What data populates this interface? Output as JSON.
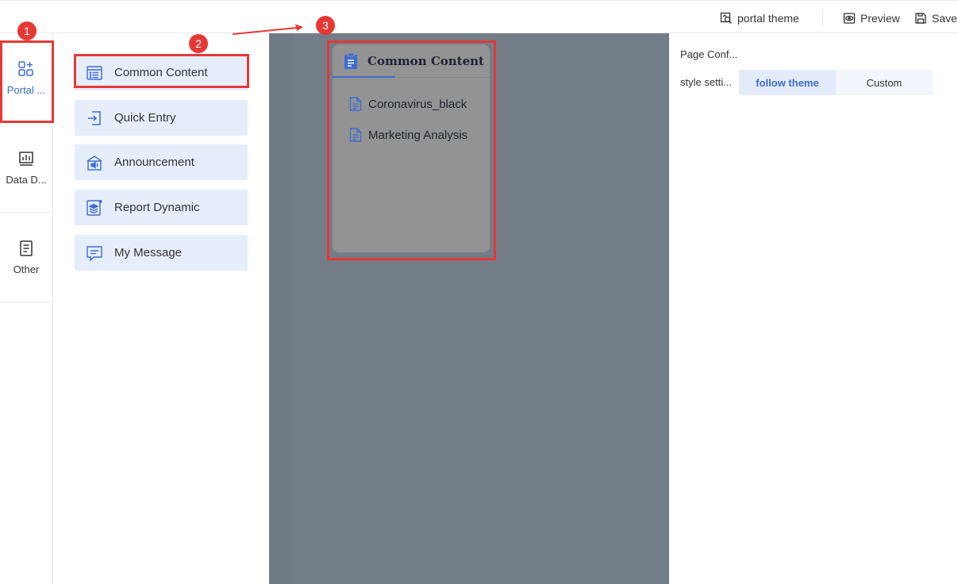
{
  "topbar": {
    "theme_label": "portal theme",
    "preview_label": "Preview",
    "save_label": "Save"
  },
  "rail": {
    "items": [
      {
        "label": "Portal ...",
        "icon": "apps-add-icon",
        "active": true
      },
      {
        "label": "Data D...",
        "icon": "chart-icon",
        "active": false
      },
      {
        "label": "Other",
        "icon": "document-icon",
        "active": false
      }
    ]
  },
  "components": [
    {
      "label": "Common Content",
      "icon": "list-icon"
    },
    {
      "label": "Quick Entry",
      "icon": "entry-icon"
    },
    {
      "label": "Announcement",
      "icon": "announcement-icon"
    },
    {
      "label": "Report Dynamic",
      "icon": "layers-icon"
    },
    {
      "label": "My Message",
      "icon": "message-icon"
    }
  ],
  "canvas": {
    "card": {
      "title": "Common Content",
      "items": [
        "Coronavirus_black",
        "Marketing Analysis"
      ]
    }
  },
  "panel": {
    "page_config_label": "Page Conf...",
    "style_label": "style setti...",
    "style_options": [
      "follow theme",
      "Custom"
    ],
    "style_selected": "follow theme"
  },
  "annotations": {
    "badges": [
      "1",
      "2",
      "3"
    ]
  },
  "colors": {
    "accent": "#3e6cd1",
    "annotation_red": "#e53935",
    "canvas_bg": "#737d88",
    "card_bg": "#939393",
    "component_bg": "#e6eefc"
  }
}
